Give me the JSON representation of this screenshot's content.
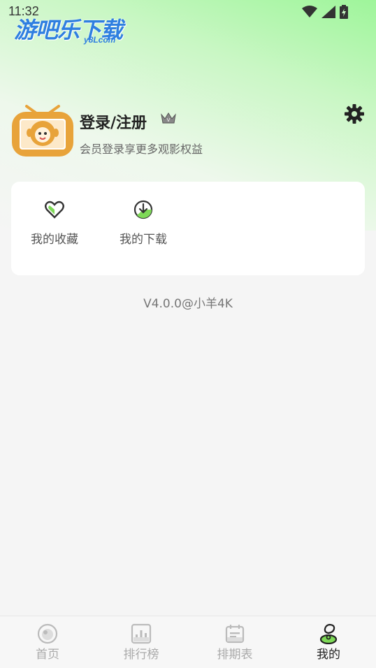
{
  "status": {
    "time": "11:32"
  },
  "watermark": {
    "text": "游吧乐下载",
    "sub": "y8Lcom"
  },
  "profile": {
    "title": "登录/注册",
    "subtitle": "会员登录享更多观影权益"
  },
  "card": {
    "items": [
      {
        "label": "我的收藏",
        "icon": "heart-icon"
      },
      {
        "label": "我的下载",
        "icon": "download-icon"
      }
    ]
  },
  "version": "V4.0.0@小羊4K",
  "tabs": [
    {
      "label": "首页",
      "icon": "home-icon",
      "active": false
    },
    {
      "label": "排行榜",
      "icon": "ranking-icon",
      "active": false
    },
    {
      "label": "排期表",
      "icon": "calendar-icon",
      "active": false
    },
    {
      "label": "我的",
      "icon": "profile-icon",
      "active": true
    }
  ],
  "colors": {
    "accent": "#7ed957",
    "gradient_top": "#9ef59a",
    "text_dark": "#222222",
    "tab_inactive": "#aaaaaa"
  }
}
